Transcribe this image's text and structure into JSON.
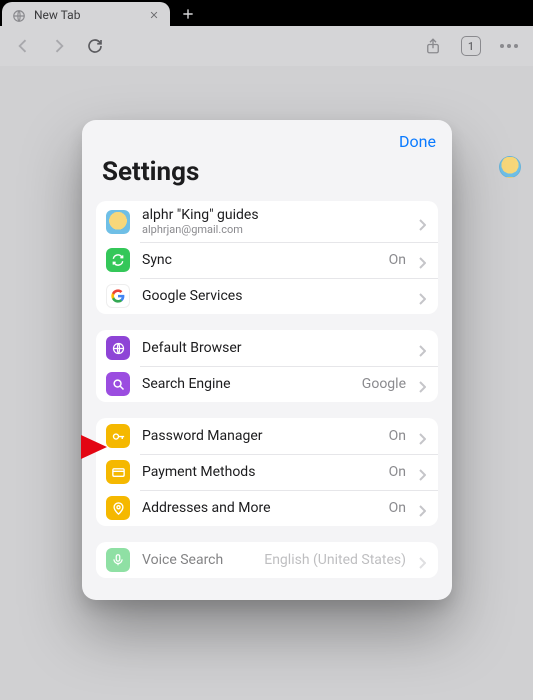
{
  "browser": {
    "tab_title": "New Tab",
    "tabs_count": "1"
  },
  "modal": {
    "done_label": "Done",
    "title": "Settings"
  },
  "account": {
    "name": "alphr \"King\" guides",
    "email": "alphrjan@gmail.com"
  },
  "rows": {
    "sync": {
      "label": "Sync",
      "value": "On"
    },
    "google_services": {
      "label": "Google Services"
    },
    "default_browser": {
      "label": "Default Browser"
    },
    "search_engine": {
      "label": "Search Engine",
      "value": "Google"
    },
    "password_manager": {
      "label": "Password Manager",
      "value": "On"
    },
    "payment_methods": {
      "label": "Payment Methods",
      "value": "On"
    },
    "addresses": {
      "label": "Addresses and More",
      "value": "On"
    },
    "voice_search": {
      "label": "Voice Search",
      "value": "English (United States)"
    }
  }
}
